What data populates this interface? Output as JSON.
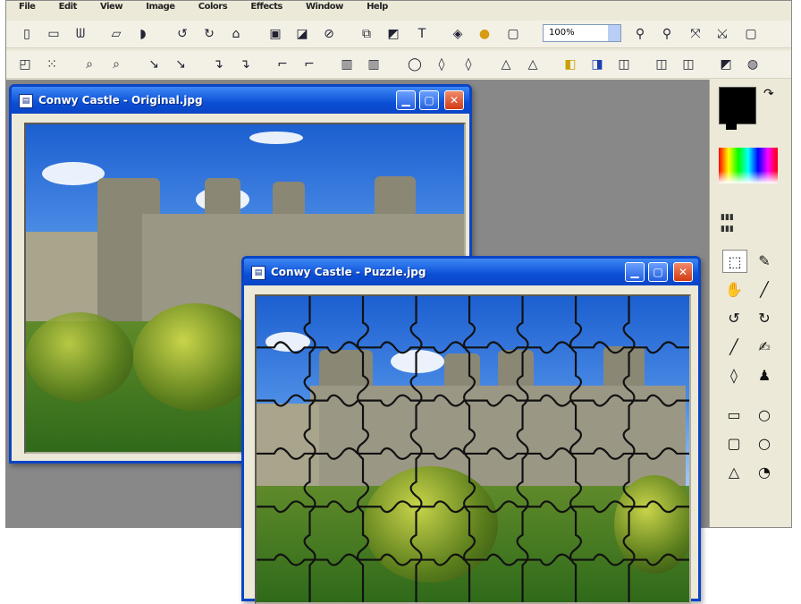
{
  "app": {
    "menu": [
      "File",
      "Edit",
      "View",
      "Image",
      "Colors",
      "Effects",
      "Window",
      "Help"
    ],
    "zoom_value": "100%",
    "primary_color": "#000000",
    "secondary_color": "#ffffff"
  },
  "toolbar1": {
    "icons": [
      "new-icon",
      "open-icon",
      "save-icon",
      "print-icon",
      "cut-icon",
      "copy-icon",
      "paste-icon",
      "undo-icon",
      "redo-icon",
      "resize-icon",
      "crop-icon",
      "rotate-icon",
      "flip-icon",
      "text-icon",
      "fill-icon",
      "color-icon",
      "histogram-icon"
    ],
    "right_icons": [
      "zoom-in-icon",
      "zoom-out-icon",
      "fit-icon",
      "actual-size-icon",
      "fullscreen-icon"
    ]
  },
  "toolbar2": {
    "icons": [
      "select-rect-icon",
      "select-ellipse-icon",
      "move-icon",
      "lasso-icon",
      "magic-wand-icon",
      "pan-icon",
      "line-icon",
      "curve-icon",
      "brush-icon",
      "pencil-icon",
      "eraser-icon",
      "clone-icon",
      "blur-icon",
      "sharpen-icon",
      "dodge-icon",
      "burn-icon",
      "smudge-icon",
      "layers-icon",
      "effect-icon",
      "puzzle-icon"
    ]
  },
  "window_original": {
    "title": "Conwy Castle - Original.jpg"
  },
  "window_puzzle": {
    "title": "Conwy Castle - Puzzle.jpg"
  },
  "tools": {
    "items": [
      "select-tool",
      "eyedropper-tool",
      "hand-tool",
      "line-tool",
      "lasso-tool",
      "curve-tool",
      "brush-tool",
      "pen-tool",
      "drop-tool",
      "stamp-tool",
      "rectangle-tool",
      "ellipse-tool",
      "rounded-rect-tool",
      "circle-tool",
      "polygon-tool",
      "freeform-tool"
    ]
  },
  "colors": {
    "title_start": "#3d88f5",
    "title_end": "#0a45c6",
    "frame": "#ece9d8",
    "workspace": "#888888"
  }
}
